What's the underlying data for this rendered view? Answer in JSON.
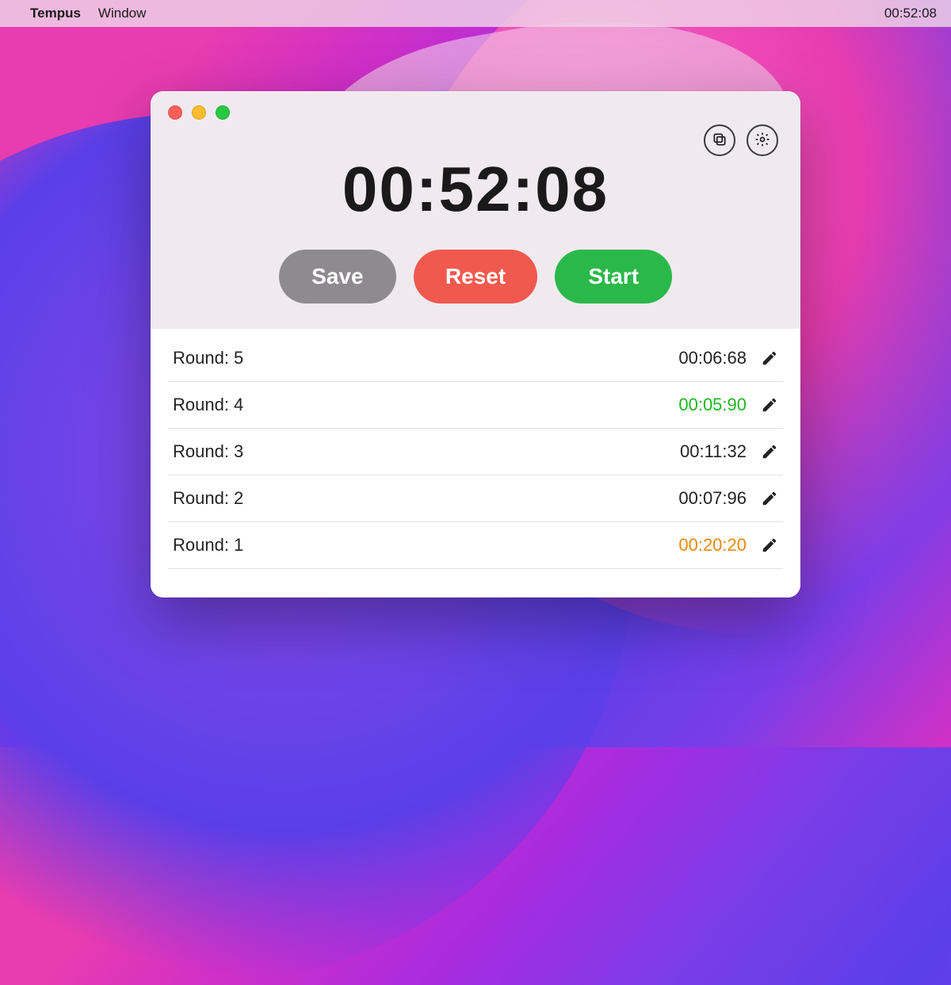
{
  "menubar": {
    "app_name": "Tempus",
    "menu_items": [
      "Window"
    ],
    "clock": "00:52:08"
  },
  "timer": {
    "display": "00:52:08"
  },
  "buttons": {
    "save": "Save",
    "reset": "Reset",
    "start": "Start"
  },
  "rounds": [
    {
      "label": "Round: 5",
      "time": "00:06:68",
      "highlight": "default"
    },
    {
      "label": "Round: 4",
      "time": "00:05:90",
      "highlight": "best"
    },
    {
      "label": "Round: 3",
      "time": "00:11:32",
      "highlight": "default"
    },
    {
      "label": "Round: 2",
      "time": "00:07:96",
      "highlight": "default"
    },
    {
      "label": "Round: 1",
      "time": "00:20:20",
      "highlight": "worst"
    }
  ],
  "colors": {
    "save_button": "#8e8b90",
    "reset_button": "#f1594f",
    "start_button": "#2bb84a",
    "best_time": "#1db61d",
    "worst_time": "#e8890c"
  }
}
